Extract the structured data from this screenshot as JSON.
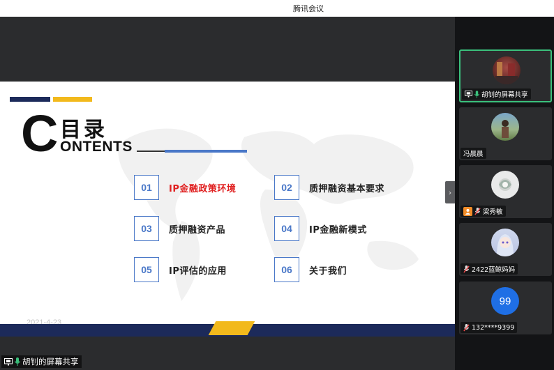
{
  "window": {
    "title": "腾讯会议"
  },
  "slide": {
    "heading_letter": "C",
    "heading_cn": "目录",
    "heading_en": "ONTENTS",
    "date": "2021-4-23",
    "items": [
      {
        "num": "01",
        "label": "IP金融政策环境",
        "active": true
      },
      {
        "num": "02",
        "label": "质押融资基本要求"
      },
      {
        "num": "03",
        "label": "质押融资产品"
      },
      {
        "num": "04",
        "label": "IP金融新模式"
      },
      {
        "num": "05",
        "label": "IP评估的应用"
      },
      {
        "num": "06",
        "label": "关于我们"
      }
    ]
  },
  "share": {
    "label": "胡钊的屏幕共享"
  },
  "participants": [
    {
      "name": "胡钊的屏幕共享",
      "active": true,
      "icons": [
        "screen-share-icon",
        "mic-on-icon"
      ]
    },
    {
      "name": "冯晨晨",
      "icons": []
    },
    {
      "name": "梁秀敏",
      "icons": [
        "host-icon",
        "mic-muted-icon"
      ]
    },
    {
      "name": "2422蓝鲸妈妈",
      "icons": [
        "mic-muted-icon"
      ]
    },
    {
      "name": "132****9399",
      "avatar_text": "99",
      "icons": [
        "mic-muted-icon"
      ]
    }
  ],
  "colors": {
    "accent_green": "#3bc07c",
    "navy": "#1c2a5a",
    "gold": "#f2b91c",
    "item_blue": "#4a78c8",
    "active_red": "#e02020",
    "avatar_blue": "#1f6fe5"
  }
}
